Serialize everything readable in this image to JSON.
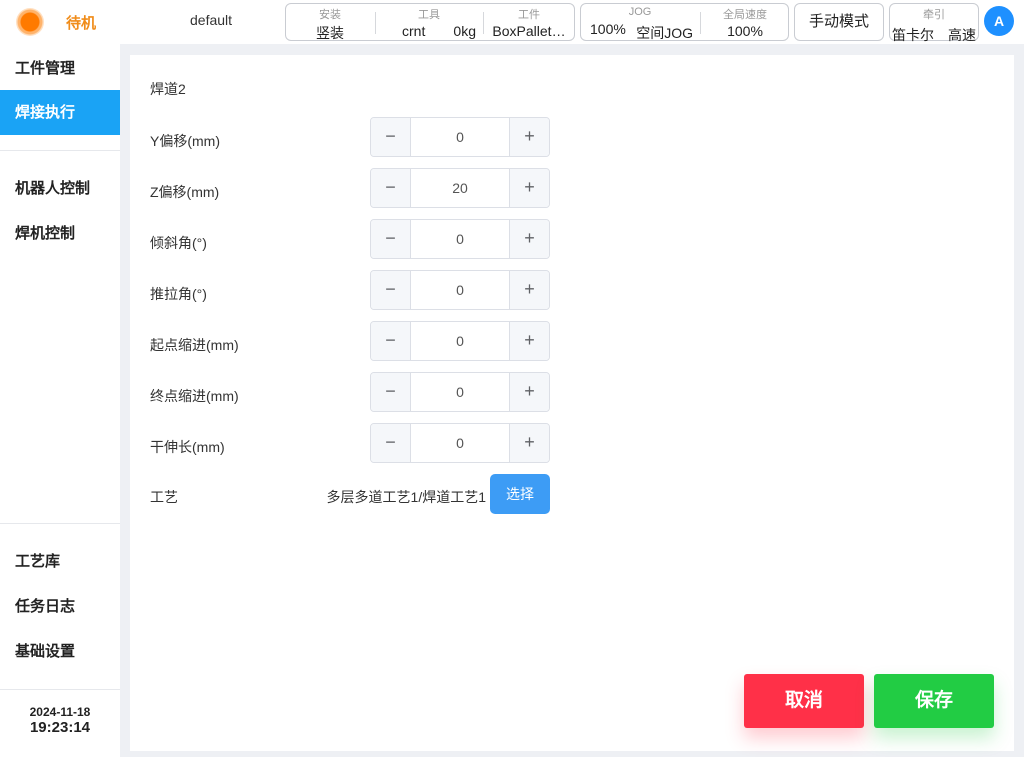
{
  "header": {
    "status_text": "待机",
    "profile_name": "default",
    "install": {
      "caption": "安装",
      "value": "竖装"
    },
    "tool": {
      "caption": "工具",
      "name": "crnt",
      "weight": "0kg"
    },
    "workpiece": {
      "caption": "工件",
      "value": "BoxPallet…"
    },
    "jog": {
      "caption": "JOG",
      "speed": "100%",
      "mode": "空间JOG"
    },
    "global_speed": {
      "caption": "全局速度",
      "value": "100%"
    },
    "mode_button": "手动模式",
    "traction": {
      "caption": "牵引",
      "coord": "笛卡尔",
      "speed": "高速"
    },
    "avatar_letter": "A"
  },
  "sidebar": {
    "items": [
      {
        "label": "工件管理"
      },
      {
        "label": "焊接执行"
      },
      {
        "label": "机器人控制"
      },
      {
        "label": "焊机控制"
      },
      {
        "label": "工艺库"
      },
      {
        "label": "任务日志"
      },
      {
        "label": "基础设置"
      }
    ],
    "active_index": 1,
    "date": "2024-11-18",
    "time": "19:23:14"
  },
  "main": {
    "title": "焊道2",
    "fields": [
      {
        "label": "Y偏移(mm)",
        "value": "0"
      },
      {
        "label": "Z偏移(mm)",
        "value": "20"
      },
      {
        "label": "倾斜角(°)",
        "value": "0"
      },
      {
        "label": "推拉角(°)",
        "value": "0"
      },
      {
        "label": "起点缩进(mm)",
        "value": "0"
      },
      {
        "label": "终点缩进(mm)",
        "value": "0"
      },
      {
        "label": "干伸长(mm)",
        "value": "0"
      }
    ],
    "minus_symbol": "−",
    "plus_symbol": "+",
    "process": {
      "label": "工艺",
      "value": "多层多道工艺1/焊道工艺1",
      "button": "选择"
    }
  },
  "actions": {
    "cancel": "取消",
    "save": "保存"
  },
  "colors": {
    "accent": "#1aa3f5",
    "status": "#f08c1a",
    "cancel": "#ff3048",
    "save": "#22cc44"
  }
}
